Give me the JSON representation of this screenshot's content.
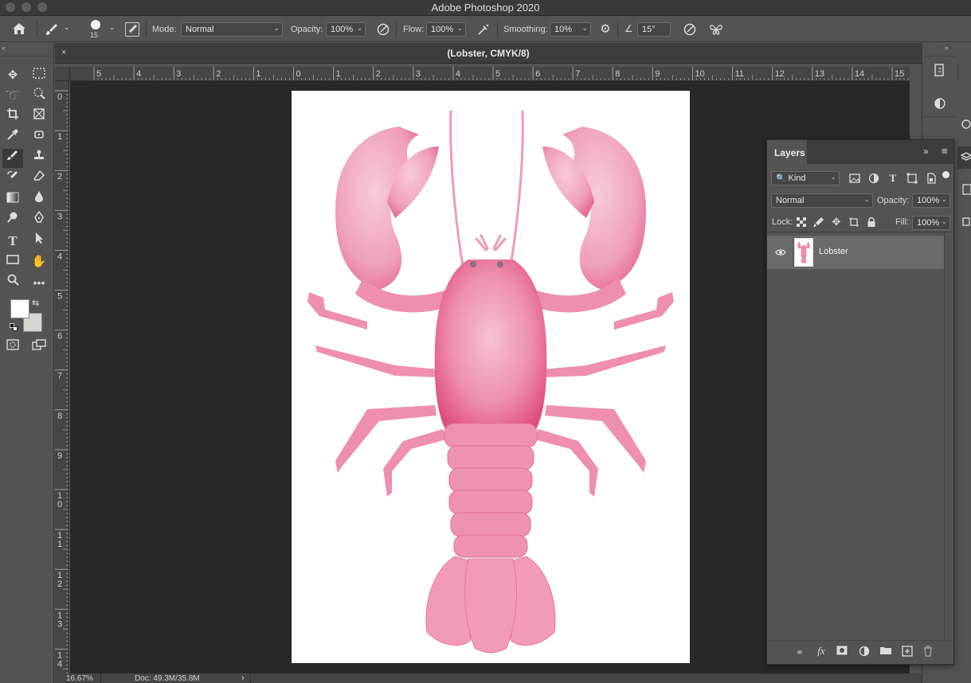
{
  "app": {
    "title": "Adobe Photoshop 2020"
  },
  "options": {
    "brush_size": "15",
    "mode_label": "Mode:",
    "mode_value": "Normal",
    "opacity_label": "Opacity:",
    "opacity_value": "100%",
    "flow_label": "Flow:",
    "flow_value": "100%",
    "smoothing_label": "Smoothing:",
    "smoothing_value": "10%",
    "angle_value": "15°"
  },
  "document": {
    "tab_title": "(Lobster, CMYK/8)",
    "zoom": "16.67%",
    "doc_size": "Doc: 49.3M/35.8M"
  },
  "rulers": {
    "horizontal": [
      "5",
      "4",
      "3",
      "2",
      "1",
      "0",
      "1",
      "2",
      "3",
      "4",
      "5",
      "6",
      "7",
      "8",
      "9",
      "10",
      "11",
      "12",
      "13",
      "14",
      "15"
    ],
    "vertical": [
      "0",
      "1",
      "2",
      "3",
      "4",
      "5",
      "6",
      "7",
      "8",
      "9",
      "1\n0",
      "1\n1",
      "1\n2",
      "1\n3",
      "1\n4"
    ]
  },
  "layers_panel": {
    "tab": "Layers",
    "filter_kind": "Kind",
    "blend_mode": "Normal",
    "opacity_label": "Opacity:",
    "opacity_value": "100%",
    "lock_label": "Lock:",
    "fill_label": "Fill:",
    "fill_value": "100%",
    "layers": [
      {
        "name": "Lobster",
        "visible": true
      }
    ]
  },
  "colors": {
    "accent_pink": "#e9739a",
    "pink_dark": "#e04a7e",
    "foreground": "#ffffff",
    "background": "#d6d6d2"
  }
}
